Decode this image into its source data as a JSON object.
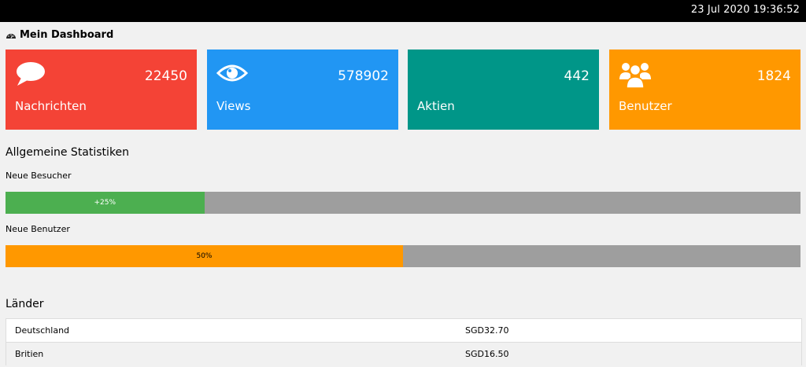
{
  "topbar": {
    "datetime": "23 Jul 2020 19:36:52"
  },
  "dashboard": {
    "title": "Mein Dashboard",
    "icon": "dashboard-icon"
  },
  "cards": [
    {
      "icon": "comment-icon",
      "count": "22450",
      "label": "Nachrichten",
      "color": "#f44336"
    },
    {
      "icon": "eye-icon",
      "count": "578902",
      "label": "Views",
      "color": "#2196f3"
    },
    {
      "icon": "share-icon",
      "count": "442",
      "label": "Aktien",
      "color": "#009688"
    },
    {
      "icon": "users-icon",
      "count": "1824",
      "label": "Benutzer",
      "color": "#ff9800"
    }
  ],
  "stats": {
    "title": "Allgemeine Statistiken",
    "bars": [
      {
        "label": "Neue Besucher",
        "value_text": "+25%",
        "value": 0.25,
        "color": "#4caf50",
        "text_color": "#ffffff"
      },
      {
        "label": "Neue Benutzer",
        "value_text": "50%",
        "value": 0.5,
        "color": "#ff9800",
        "text_color": "#000000"
      }
    ]
  },
  "countries": {
    "title": "Länder",
    "rows": [
      {
        "name": "Deutschland",
        "value": "SGD32.70"
      },
      {
        "name": "Britien",
        "value": "SGD16.50"
      }
    ]
  },
  "colors": {
    "background": "#f1f1f1",
    "bar_track": "#9e9e9e",
    "topbar": "#000000"
  }
}
